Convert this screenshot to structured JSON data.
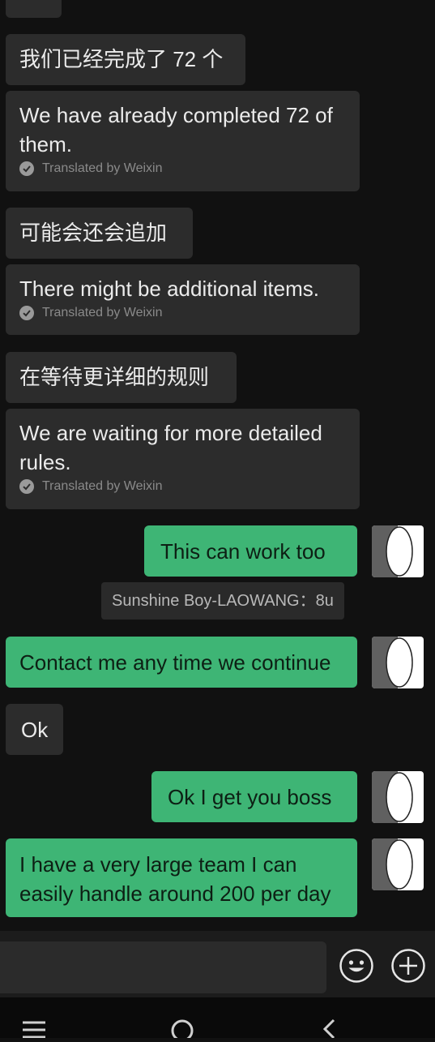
{
  "messages": {
    "m1_original": "我们已经完成了 72 个",
    "m1_translation": "We have already completed 72 of them.",
    "m2_original": "可能会还会追加",
    "m2_translation": "There might be additional items.",
    "m3_original": "在等待更详细的规则",
    "m3_translation": "We are waiting for more detailed rules.",
    "translated_by": "Translated by Weixin",
    "out1": "This can work too",
    "system_notice": "Sunshine Boy-LAOWANG：8u",
    "out2": "Contact me any time we continue",
    "in_ok": "Ok",
    "out3": "Ok I get you boss",
    "out4": "I have a very large team I can easily handle around 200 per day"
  },
  "input_bar": {
    "emoji_icon": "smiley-face-icon",
    "more_icon": "plus-circle-icon"
  },
  "nav_bar": {
    "icons": [
      "menu-icon",
      "home-circle-icon",
      "back-chevron-icon"
    ]
  },
  "colors": {
    "outgoing_bubble": "#3eb575",
    "incoming_bubble": "#2c2c2c",
    "background": "#111111"
  }
}
